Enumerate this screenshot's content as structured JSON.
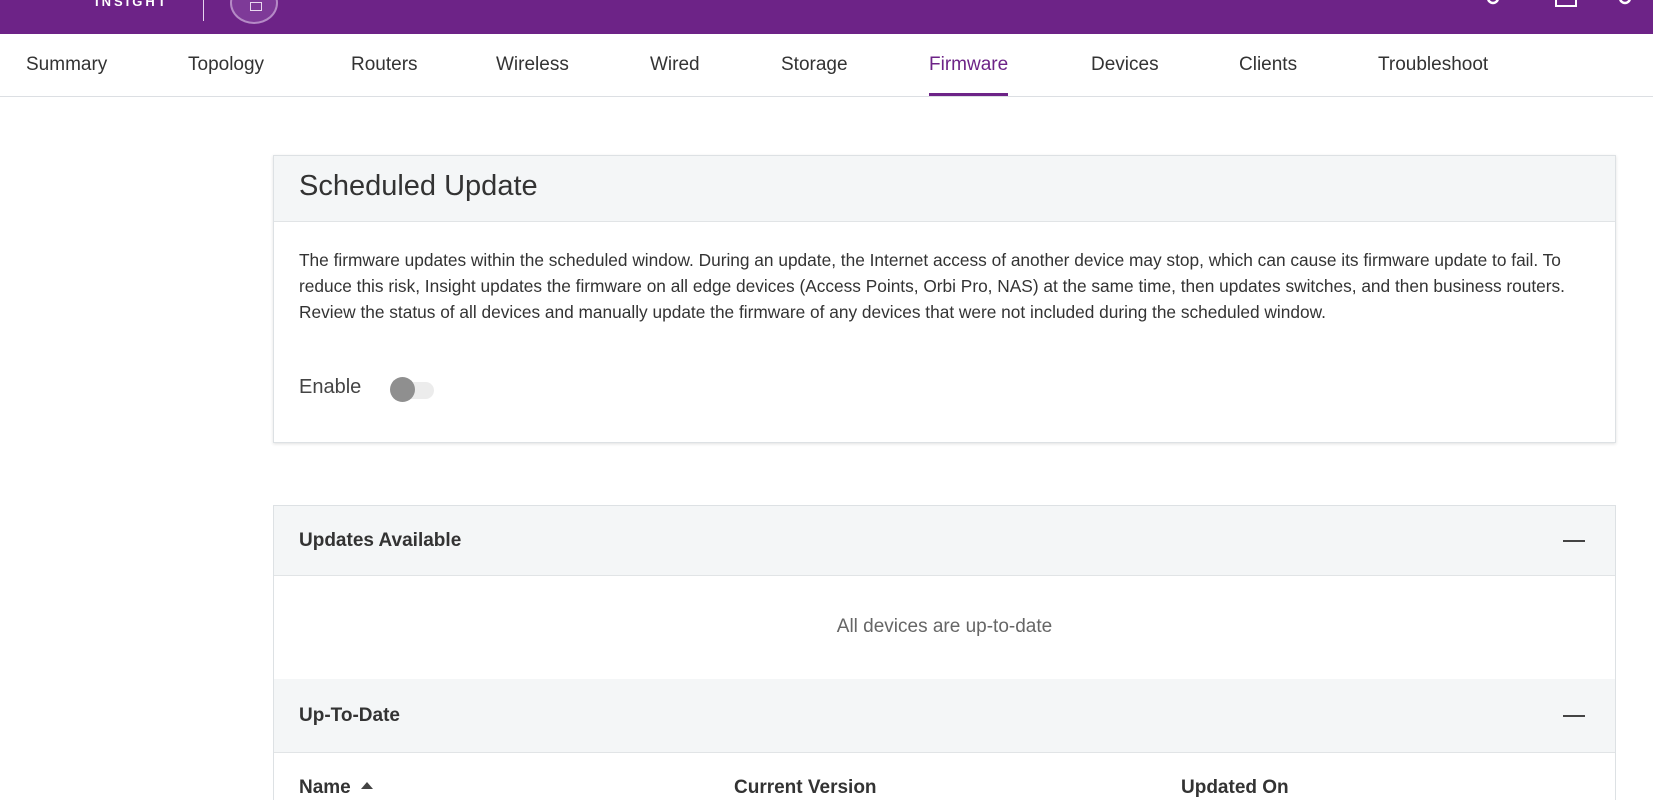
{
  "brand": {
    "name": "INSIGHT"
  },
  "colors": {
    "accent": "#6d2387",
    "header_bg": "#f4f6f7",
    "toggle_off": "#8f8f8f"
  },
  "top_icons": [
    "settings-icon",
    "square-icon",
    "gear-icon"
  ],
  "tabs": [
    {
      "label": "Summary"
    },
    {
      "label": "Topology"
    },
    {
      "label": "Routers"
    },
    {
      "label": "Wireless"
    },
    {
      "label": "Wired"
    },
    {
      "label": "Storage"
    },
    {
      "label": "Firmware",
      "active": true
    },
    {
      "label": "Devices"
    },
    {
      "label": "Clients"
    },
    {
      "label": "Troubleshoot"
    }
  ],
  "scheduled_update": {
    "title": "Scheduled Update",
    "description": "The firmware updates within the scheduled window. During an update, the Internet access of another device may stop, which can cause its firmware update to fail. To reduce this risk, Insight updates the firmware on all edge devices (Access Points, Orbi Pro, NAS) at the same time, then updates switches, and then business routers. Review the status of all devices and manually update the firmware of any devices that were not included during the scheduled window.",
    "enable_label": "Enable",
    "enabled": false
  },
  "updates_available": {
    "title": "Updates Available",
    "empty_message": "All devices are up-to-date"
  },
  "up_to_date": {
    "title": "Up-To-Date",
    "columns": [
      "Name",
      "Current Version",
      "Updated On"
    ],
    "sort_column": "Name",
    "sort_direction": "ascending"
  }
}
